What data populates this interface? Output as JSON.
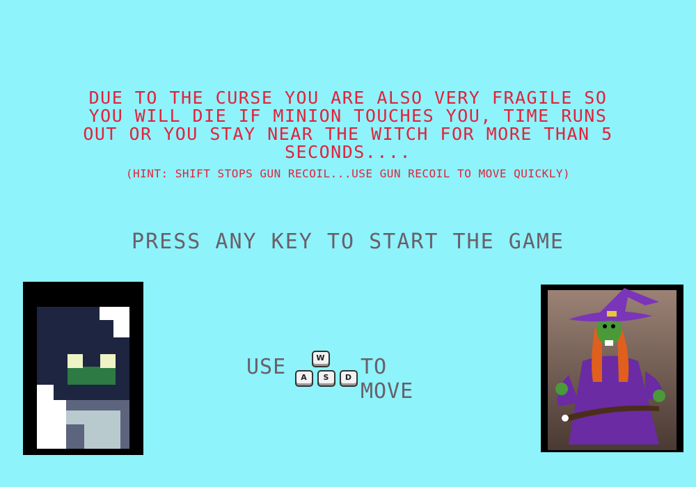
{
  "story_text": "DUE TO THE CURSE YOU ARE ALSO VERY FRAGILE SO YOU WILL DIE IF MINION TOUCHES YOU, TIME RUNS OUT OR YOU STAY NEAR THE WITCH FOR MORE THAN 5 SECONDS....",
  "hint_text": "(HINT: SHIFT STOPS GUN RECOIL...USE GUN RECOIL TO MOVE QUICKLY)",
  "start_prompt": "PRESS ANY KEY TO START THE GAME",
  "controls": {
    "use_label": "USE",
    "move_label": "TO MOVE",
    "keys": {
      "w": "W",
      "a": "A",
      "s": "S",
      "d": "D"
    }
  },
  "colors": {
    "background": "#8ef3fb",
    "story_text": "#e2223b",
    "prompt_text": "#6a5f68"
  },
  "portraits": {
    "player_icon": "hooded-player-sprite",
    "witch_icon": "witch-portrait"
  }
}
